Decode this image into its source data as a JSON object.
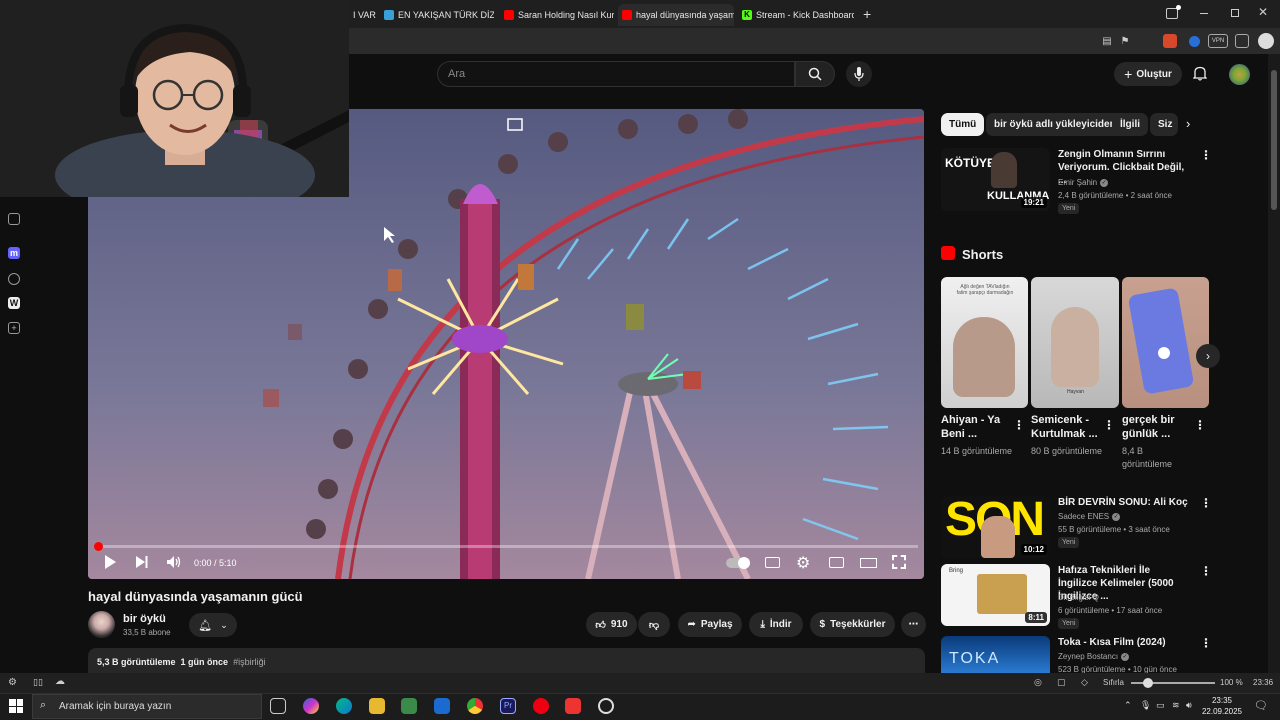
{
  "browser": {
    "tabs": [
      {
        "label": "I VAR",
        "color": "#555555"
      },
      {
        "label": "EN YAKIŞAN TÜRK DİZİ ÇİF",
        "color": "#3aa0d8"
      },
      {
        "label": "Saran Holding Nasıl Kuruldu",
        "color": "#ff0000"
      },
      {
        "label": "hayal dünyasında yaşamanı",
        "color": "#ff0000"
      },
      {
        "label": "Stream - Kick Dashboard",
        "color": "#53fc18"
      }
    ],
    "new_tab": "+"
  },
  "header": {
    "search_placeholder": "Ara",
    "create_label": "Oluştur"
  },
  "video": {
    "time": "0:00 / 5:10",
    "title": "hayal dünyasında yaşamanın gücü",
    "progress": 0.0
  },
  "channel": {
    "name": "bir öykü",
    "subs": "33,5 B abone"
  },
  "actions": {
    "likes": "910",
    "share": "Paylaş",
    "download": "İndir",
    "thanks": "Teşekkürler"
  },
  "description": {
    "views": "5,3 B görüntüleme",
    "date": "1 gün önce",
    "tag": "#işbirliği"
  },
  "chips": [
    "Tümü",
    "bir öykü adlı yükleyiciden",
    "İlgili",
    "Siz"
  ],
  "related": [
    {
      "title": "Zengin Olmanın Sırrını Veriyorum. Clickbait Değil, ...",
      "channel": "Emir Şahin",
      "meta": "2,4 B görüntüleme • 2 saat önce",
      "badge": "Yeni",
      "duration": "19:21",
      "thumb_text_1": "KÖTÜYE",
      "thumb_text_2": "KULLANMA"
    },
    {
      "title": "BİR DEVRİN SONU: Ali Koç",
      "channel": "Sadece ENES",
      "meta": "55 B görüntüleme • 3 saat önce",
      "badge": "Yeni",
      "duration": "10:12",
      "thumb_text_1": "SON"
    },
    {
      "title": "Hafıza Teknikleri İle İngilizce Kelimeler  (5000 İngilizce ...",
      "channel": "Dil Bilgisi Q",
      "meta": "6 görüntüleme • 17 saat önce",
      "badge": "Yeni",
      "duration": "8:11",
      "thumb_text_1": "Bring"
    },
    {
      "title": "Toka - Kısa Film (2024)",
      "channel": "Zeynep Bostancı",
      "meta": "523 B görüntüleme • 10 gün önce",
      "thumb_text_1": "TOKA"
    }
  ],
  "shorts": {
    "heading": "Shorts",
    "items": [
      {
        "title": "Ahiyan - Ya Beni ...",
        "views": "14 B görüntüleme",
        "overlay": "Ağlı değen TAVladığın fatim şarapçı darmadağın"
      },
      {
        "title": "Semicenk - Kurtulmak ...",
        "views": "80 B görüntüleme",
        "overlay": "Hayvan"
      },
      {
        "title": "gerçek bir günlük ...",
        "views": "8,4 B görüntüleme",
        "overlay": ""
      }
    ]
  },
  "statusbar": {
    "reset": "Sıfırla",
    "zoom": "100 %",
    "time": "23:36"
  },
  "taskbar": {
    "search_placeholder": "Aramak için buraya yazın",
    "clock_time": "23:35",
    "clock_date": "22.09.2025"
  },
  "colors": {
    "bg": "#0f0f0f",
    "accent_red": "#ff0000",
    "chip_bg": "#272727"
  }
}
